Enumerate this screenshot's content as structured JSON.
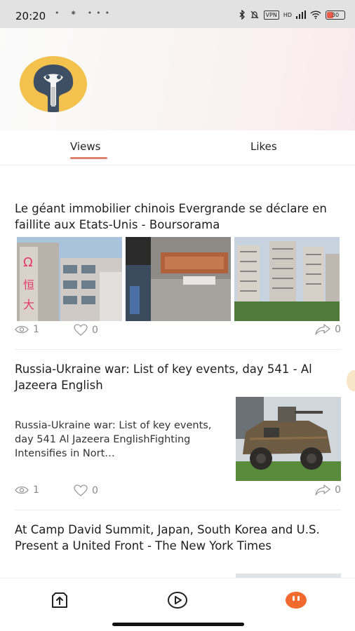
{
  "status_bar": {
    "time": "20:20",
    "left_icons": "• ⁕ •••",
    "vpn": "VPN",
    "network": "HD",
    "battery": "30"
  },
  "profile": {
    "avatar_icon": "cobra-avatar-icon",
    "avatar_bg": "#f2c14e"
  },
  "tabs": [
    {
      "label": "Views",
      "active": true
    },
    {
      "label": "Likes",
      "active": false
    }
  ],
  "accent_color": "#e0826d",
  "articles": [
    {
      "title": "Le géant immobilier chinois Evergrande se déclare en faillite aux Etats-Unis - Boursorama",
      "views": "1",
      "likes": "0",
      "shares": "0"
    },
    {
      "title": "Russia-Ukraine war: List of key events, day 541 - Al Jazeera English",
      "snippet": "Russia-Ukraine war: List of key events, day 541  Al Jazeera EnglishFighting Intensifies in Nort…",
      "views": "1",
      "likes": "0",
      "shares": "0"
    },
    {
      "title": "At Camp David Summit, Japan, South Korea and U.S. Present a United Front - The New York Times"
    }
  ],
  "bottom_nav": [
    {
      "icon": "upload-icon"
    },
    {
      "icon": "play-icon"
    },
    {
      "icon": "profile-face-icon",
      "color": "#f26a2e"
    }
  ]
}
